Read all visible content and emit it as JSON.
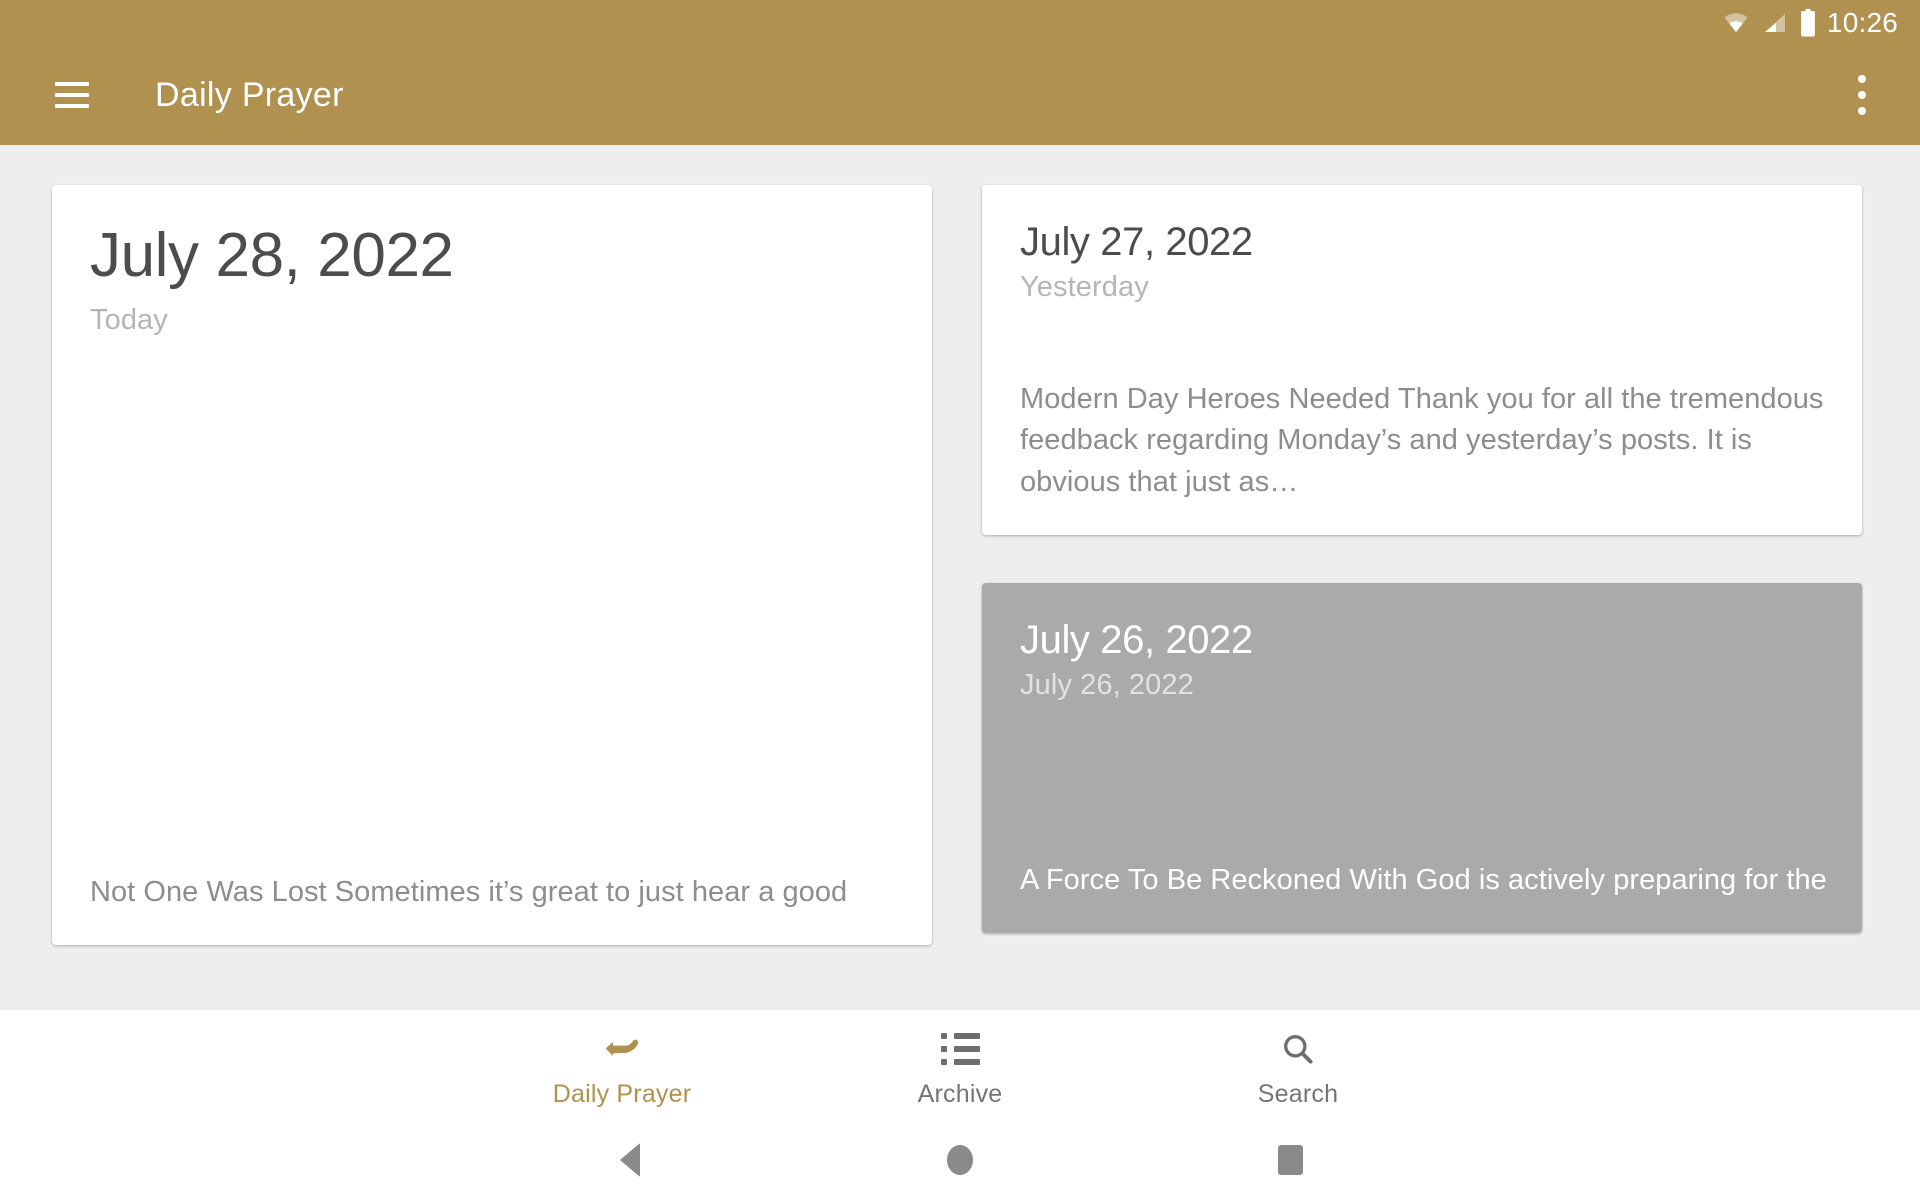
{
  "status_bar": {
    "time": "10:26",
    "icons": [
      "wifi-icon",
      "cellular-signal-icon",
      "battery-icon"
    ]
  },
  "app_bar": {
    "menu_icon": "hamburger-menu-icon",
    "title": "Daily Prayer",
    "overflow_icon": "overflow-menu-icon",
    "background_color": "#b09150",
    "text_color": "#ffffff"
  },
  "content": {
    "background_color": "#eeeeee",
    "today_card": {
      "title": "July 28, 2022",
      "subtitle": "Today",
      "body": "Not One Was Lost Sometimes it’s great to just hear a good",
      "selected": false
    },
    "right_cards": [
      {
        "title": "July 27, 2022",
        "subtitle": "Yesterday",
        "body": "Modern Day Heroes Needed Thank you for all the tremendous feedback regarding Monday’s and yesterday’s posts. It is obvious that just as…",
        "selected": false
      },
      {
        "title": "July 26, 2022",
        "subtitle": "July 26, 2022",
        "body": "A Force To Be Reckoned With God is actively preparing for the",
        "selected": true,
        "selected_color": "#aaaaaa"
      }
    ]
  },
  "bottom_nav": {
    "active_color": "#b09150",
    "inactive_color": "#757575",
    "items": [
      {
        "label": "Daily Prayer",
        "icon": "praying-hands-icon",
        "active": true
      },
      {
        "label": "Archive",
        "icon": "list-icon",
        "active": false
      },
      {
        "label": "Search",
        "icon": "search-icon",
        "active": false
      }
    ]
  },
  "system_nav": {
    "back": "back-triangle-icon",
    "home": "home-circle-icon",
    "recents": "recents-square-icon"
  }
}
